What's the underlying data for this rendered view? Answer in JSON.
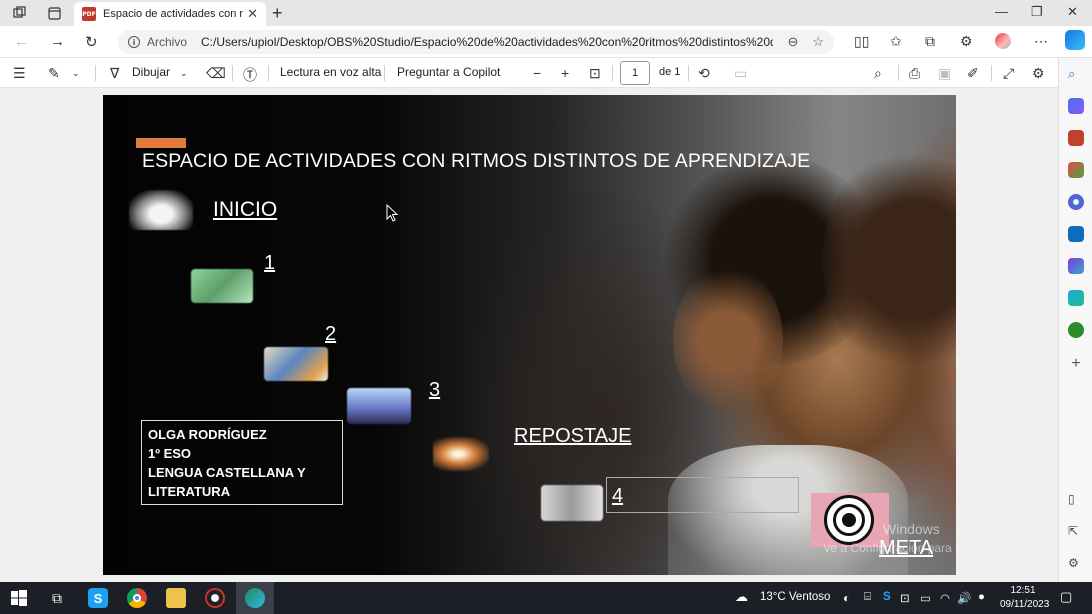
{
  "browser": {
    "tab_title": "Espacio de actividades con ritmo",
    "tab_icon_label": "PDF",
    "address_origin": "Archivo",
    "address_path": "C:/Users/upiol/Desktop/OBS%20Studio/Espacio%20de%20actividades%20con%20ritmos%20distintos%20de%20..."
  },
  "pdf_toolbar": {
    "draw_label": "Dibujar",
    "read_aloud_label": "Lectura en voz alta",
    "copilot_label": "Preguntar a Copilot",
    "page_current": "1",
    "page_total_label": "de 1"
  },
  "slide": {
    "title": "ESPACIO DE ACTIVIDADES CON RITMOS DISTINTOS DE APRENDIZAJE",
    "inicio": "INICIO",
    "n1": "1",
    "n2": "2",
    "n3": "3",
    "repostaje": "REPOSTAJE",
    "n4": "4",
    "meta": "META",
    "info_lines": [
      "OLGA RODRÍGUEZ",
      "1º ESO",
      "LENGUA CASTELLANA Y",
      "LITERATURA"
    ],
    "watermark_line1": "Windows",
    "watermark_line2": "Ve a Configuración para activar Windows."
  },
  "taskbar": {
    "weather": "13°C  Ventoso",
    "time": "12:51",
    "date": "09/11/2023"
  },
  "colors": {
    "accent_orange": "#e07b3c",
    "pdf_red": "#c5372a",
    "taskbar_bg": "#1c1f26"
  }
}
